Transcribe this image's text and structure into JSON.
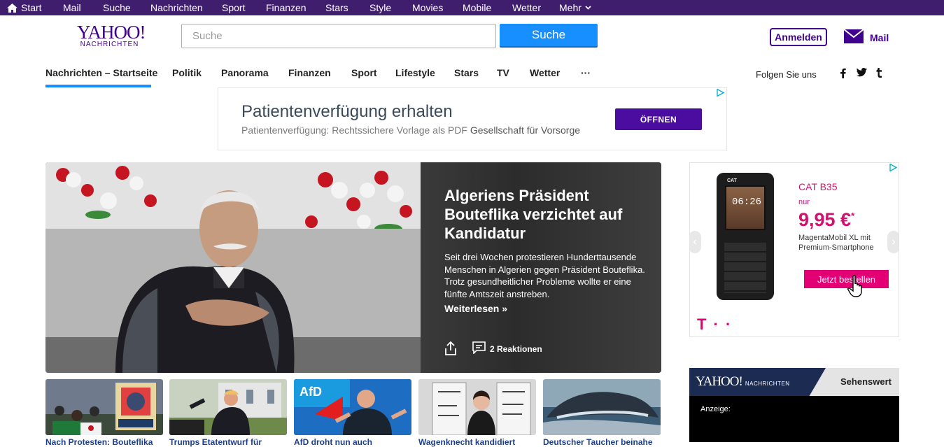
{
  "topbar": {
    "items": [
      {
        "label": "Start",
        "icon": "home-icon"
      },
      {
        "label": "Mail"
      },
      {
        "label": "Suche"
      },
      {
        "label": "Nachrichten"
      },
      {
        "label": "Sport"
      },
      {
        "label": "Finanzen"
      },
      {
        "label": "Stars"
      },
      {
        "label": "Style"
      },
      {
        "label": "Movies"
      },
      {
        "label": "Mobile"
      },
      {
        "label": "Wetter"
      },
      {
        "label": "Mehr",
        "icon": "chevron-down-icon"
      }
    ],
    "background": "#3f1e6e"
  },
  "header": {
    "logo_main": "YAHOO!",
    "logo_sub": "NACHRICHTEN",
    "search_placeholder": "Suche",
    "search_button": "Suche",
    "signin": "Anmelden",
    "mail": "Mail"
  },
  "nav": {
    "items": [
      "Nachrichten – Startseite",
      "Politik",
      "Panorama",
      "Finanzen",
      "Sport",
      "Lifestyle",
      "Stars",
      "TV",
      "Wetter",
      "···"
    ],
    "active": "Nachrichten – Startseite",
    "follow": "Folgen Sie uns",
    "social": [
      "facebook-icon",
      "twitter-icon",
      "tumblr-icon"
    ],
    "accent": "#188fff"
  },
  "ad_top": {
    "headline": "Patientenverfügung erhalten",
    "sub": "Patientenverfügung: Rechtssichere Vorlage als PDF",
    "advertiser": "Gesellschaft für Vorsorge",
    "button": "ÖFFNEN"
  },
  "hero": {
    "title": "Algeriens Präsident Bouteflika verzichtet auf Kandidatur",
    "desc": "Seit drei Wochen protestieren Hunderttausende Menschen in Algerien gegen Präsident Bouteflika. Trotz gesundheitlicher Probleme wollte er eine fünfte Amtszeit anstreben.",
    "more": "Weiterlesen »",
    "reactions": "2 Reaktionen"
  },
  "thumbs": [
    {
      "caption": "Nach Protesten: Bouteflika"
    },
    {
      "caption": "Trumps Etatentwurf für"
    },
    {
      "caption": "AfD droht nun auch"
    },
    {
      "caption": "Wagenknecht kandidiert"
    },
    {
      "caption": "Deutscher Taucher beinahe"
    }
  ],
  "ad_right": {
    "model": "CAT B35",
    "nur": "nur",
    "price": "9,95 €",
    "price_sup": "*",
    "sub": "MagentaMobil XL mit Premium-Smartphone",
    "button": "Jetzt bestellen",
    "phone_time": "06:26",
    "phone_brand": "CAT",
    "brand_mark": "T · ·",
    "brand_color": "#e20074"
  },
  "video_box": {
    "logo": "YAHOO!",
    "logo_sub": "NACHRICHTEN",
    "label": "Sehenswert",
    "ad_label": "Anzeige:"
  }
}
